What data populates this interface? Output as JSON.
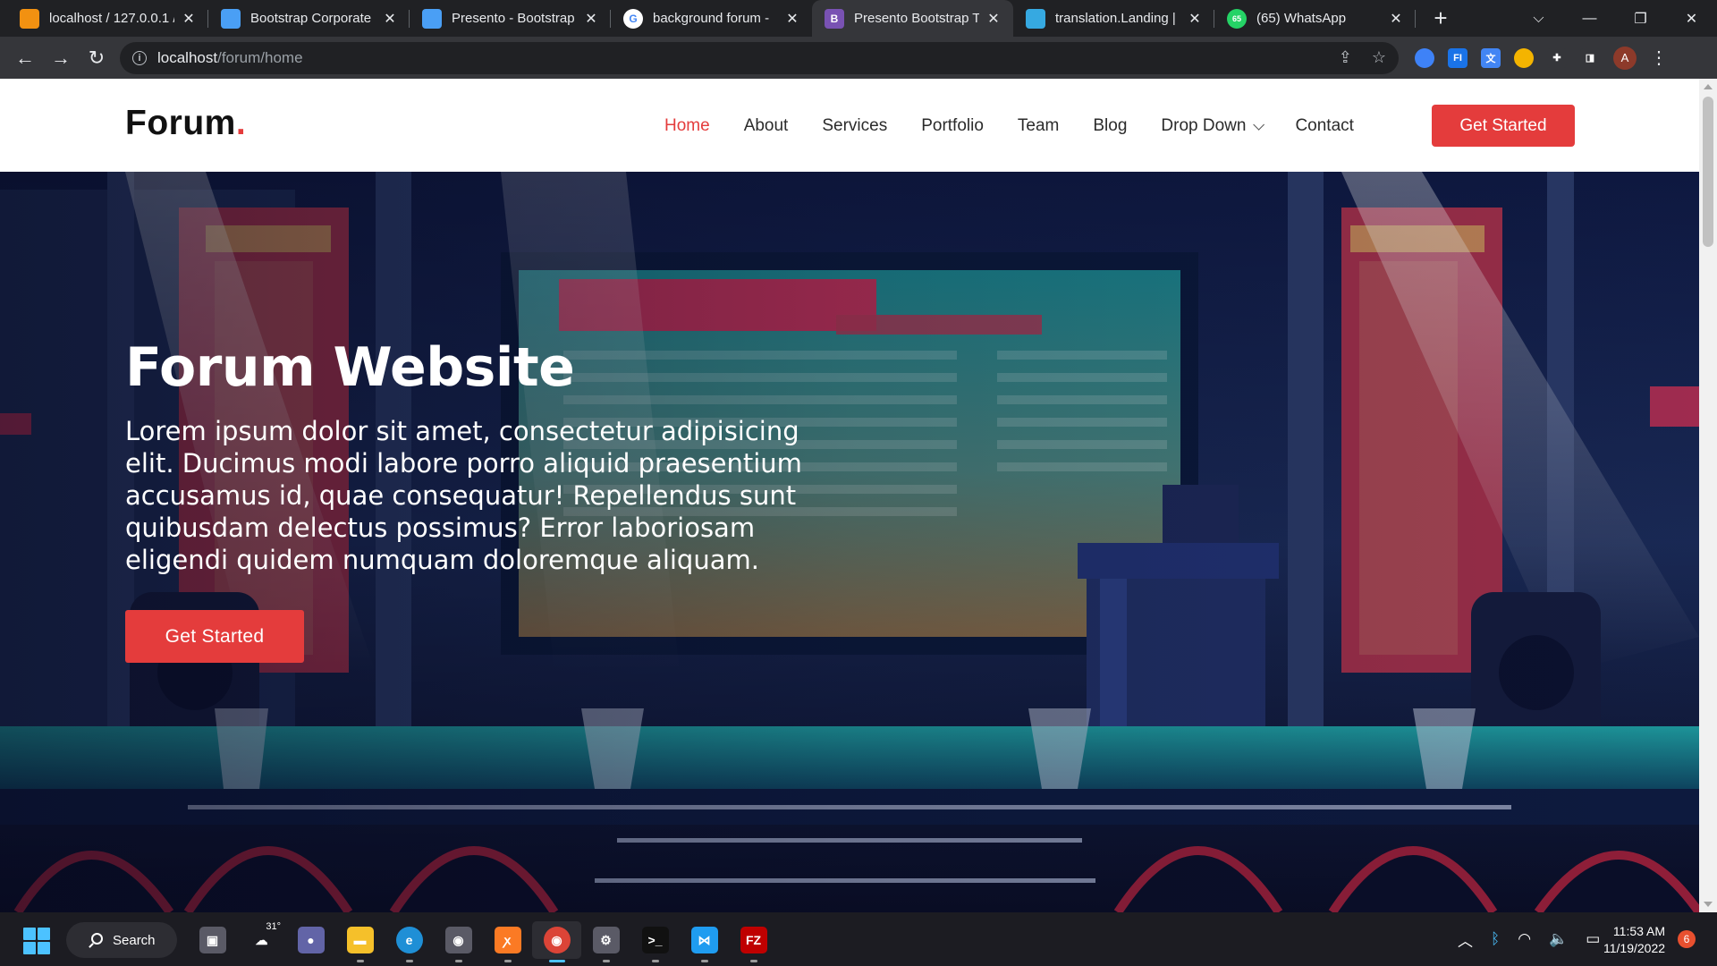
{
  "browser": {
    "tabs": [
      {
        "title": "localhost / 127.0.0.1 /",
        "favicon": "phpmyadmin-icon",
        "color": "#f29111"
      },
      {
        "title": "Bootstrap Corporate",
        "favicon": "bootstrapmade-icon",
        "color": "#4a9ff5"
      },
      {
        "title": "Presento - Bootstrap",
        "favicon": "bootstrapmade-icon",
        "color": "#4a9ff5"
      },
      {
        "title": "background forum -",
        "favicon": "google-icon",
        "color": "#ffffff"
      },
      {
        "title": "Presento Bootstrap Te",
        "favicon": "bootstrap-icon",
        "color": "#7952b3"
      },
      {
        "title": "translation.Landing |",
        "favicon": "edge-icon",
        "color": "#36a9e1"
      },
      {
        "title": "(65) WhatsApp",
        "favicon": "whatsapp-icon",
        "color": "#25d366"
      }
    ],
    "active_tab_index": 4,
    "favicon_letters": {
      "google": "G",
      "bootstrap": "B",
      "whatsapp": "65"
    },
    "url": {
      "host": "localhost",
      "path": "/forum/home"
    },
    "profile_initial": "A",
    "extensions": [
      {
        "name": "color-picker-icon",
        "color": "#3e82f7",
        "label": ""
      },
      {
        "name": "fl-extension-icon",
        "color": "#1a73e8",
        "label": "FI"
      },
      {
        "name": "translate-extension-icon",
        "color": "#4285f4",
        "label": "文"
      },
      {
        "name": "coin-extension-icon",
        "color": "#f4b400",
        "label": ""
      },
      {
        "name": "puzzle-icon",
        "color": "#35363a",
        "label": "✚"
      },
      {
        "name": "side-panel-icon",
        "color": "#35363a",
        "label": "◨"
      }
    ]
  },
  "site": {
    "logo_text": "Forum",
    "logo_dot": ".",
    "nav": [
      {
        "label": "Home",
        "active": true
      },
      {
        "label": "About"
      },
      {
        "label": "Services"
      },
      {
        "label": "Portfolio"
      },
      {
        "label": "Team"
      },
      {
        "label": "Blog"
      },
      {
        "label": "Drop Down",
        "dropdown": true
      },
      {
        "label": "Contact"
      }
    ],
    "header_cta": "Get Started",
    "hero": {
      "title": "Forum Website",
      "text": "Lorem ipsum dolor sit amet, consectetur adipisicing elit. Ducimus modi labore porro aliquid praesentium accusamus id, quae consequatur! Repellendus sunt quibusdam delectus possimus? Error laboriosam eligendi quidem numquam doloremque aliquam.",
      "cta": "Get Started"
    },
    "accent_color": "#e43c3c"
  },
  "taskbar": {
    "search_label": "Search",
    "weather_temp": "31°",
    "apps": [
      {
        "name": "task-view-icon",
        "color": "#5a5a66",
        "label": "▣"
      },
      {
        "name": "weather-icon",
        "color": "#1c1c22",
        "label": "☁"
      },
      {
        "name": "teams-chat-icon",
        "color": "#6264a7",
        "label": "●"
      },
      {
        "name": "file-explorer-icon",
        "color": "#f5c02a",
        "label": "▬"
      },
      {
        "name": "edge-icon",
        "color": "#1f8fd6",
        "label": "e"
      },
      {
        "name": "camera-icon",
        "color": "#5a5a66",
        "label": "◉"
      },
      {
        "name": "xampp-icon",
        "color": "#fb7a24",
        "label": "ꭗ"
      },
      {
        "name": "chrome-icon",
        "color": "#db4437",
        "label": "◉",
        "active": true
      },
      {
        "name": "settings-icon",
        "color": "#5a5a66",
        "label": "⚙"
      },
      {
        "name": "terminal-icon",
        "color": "#111111",
        "label": ">_"
      },
      {
        "name": "vscode-icon",
        "color": "#1f9cf0",
        "label": "⋈"
      },
      {
        "name": "filezilla-icon",
        "color": "#bf0000",
        "label": "FZ"
      }
    ],
    "time": "11:53 AM",
    "date": "11/19/2022",
    "notification_count": "6"
  }
}
